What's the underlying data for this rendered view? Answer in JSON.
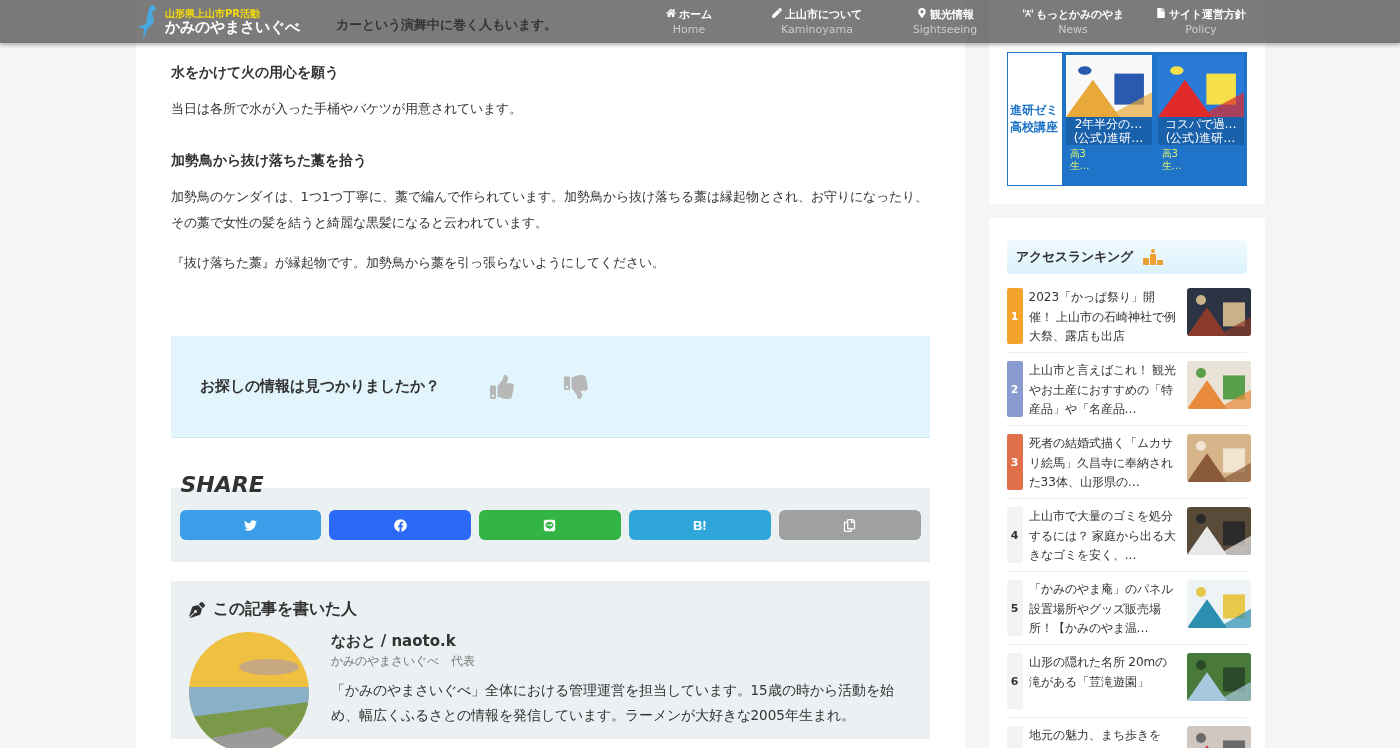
{
  "header": {
    "tagline": "山形県上山市PR活動",
    "site_name": "かみのやまさいぐべ",
    "nav": [
      {
        "label": "ホーム",
        "sub": "Home"
      },
      {
        "label": "上山市について",
        "sub": "Kaminoyama"
      },
      {
        "label": "観光情報",
        "sub": "Sightseeing"
      },
      {
        "label": "もっとかみのやま",
        "sub": "News"
      },
      {
        "label": "サイト運営方針",
        "sub": "Policy"
      }
    ]
  },
  "article": {
    "covered_line": "カーという演舞中に巻く人もいます。",
    "blocks": [
      {
        "kind": "heading",
        "text": "水をかけて火の用心を願う"
      },
      {
        "kind": "paragraph",
        "text": "当日は各所で水が入った手桶やバケツが用意されています。"
      },
      {
        "kind": "heading",
        "text": "加勢鳥から抜け落ちた藁を拾う"
      },
      {
        "kind": "paragraph",
        "text": "加勢鳥のケンダイは、1つ1つ丁寧に、藁で編んで作られています。加勢鳥から抜け落ちる藁は縁起物とされ、お守りになったり、その藁で女性の髪を結うと綺麗な黒髪になると云われています。"
      },
      {
        "kind": "paragraph",
        "text": "『抜け落ちた藁』が縁起物です。加勢鳥から藁を引っ張らないようにしてください。"
      }
    ]
  },
  "feedback": {
    "question": "お探しの情報は見つかりましたか？"
  },
  "share": {
    "title": "SHARE",
    "buttons": [
      {
        "kind": "twitter",
        "color": "#3a9fe8"
      },
      {
        "kind": "facebook",
        "color": "#2a6af7"
      },
      {
        "kind": "line",
        "color": "#33b546"
      },
      {
        "kind": "hatena",
        "label": "B!",
        "color": "#2fa6da"
      },
      {
        "kind": "copy",
        "color": "#a0a0a0"
      }
    ]
  },
  "author": {
    "heading": "この記事を書いた人",
    "name": "なおと / naoto.k",
    "role": "かみのやまさいぐべ　代表",
    "bio": "「かみのやまさいぐべ」全体における管理運営を担当しています。15歳の時から活動を始め、幅広くふるさとの情報を発信しています。ラーメンが大好きな2005年生まれ。"
  },
  "ad": {
    "brand": "進研ゼミ高校講座",
    "tiles": [
      {
        "caption": "2年半分の…",
        "source": "(公式)進研…",
        "title": "高3生…"
      },
      {
        "caption": "コスパで過…",
        "source": "(公式)進研…",
        "title": "高3生…"
      }
    ]
  },
  "ranking": {
    "title": "アクセスランキング",
    "items": [
      {
        "rank": "1",
        "color": "#f5a42b",
        "title": "2023「かっぱ祭り」開催！ 上山市の石崎神社で例大祭、露店も出店"
      },
      {
        "rank": "2",
        "color": "#8a9bd2",
        "title": "上山市と言えばこれ！ 観光やお土産におすすめの「特産品」や「名産品…"
      },
      {
        "rank": "3",
        "color": "#e0704a",
        "title": "死者の結婚式描く「ムカサリ絵馬」久昌寺に奉納された33体、山形県の…"
      },
      {
        "rank": "4",
        "color": "#f3f3f3",
        "title": "上山市で大量のゴミを処分するには？ 家庭から出る大きなゴミを安く、…"
      },
      {
        "rank": "5",
        "color": "#f3f3f3",
        "title": "「かみのやま庵」のパネル設置場所やグッズ販売場所！【かみのやま温…"
      },
      {
        "rank": "6",
        "color": "#f3f3f3",
        "title": "山形の隠れた名所 20mの滝がある「荳滝遊園」"
      },
      {
        "color": "#f3f3f3",
        "title": "地元の魅力、まち歩きを"
      }
    ]
  }
}
